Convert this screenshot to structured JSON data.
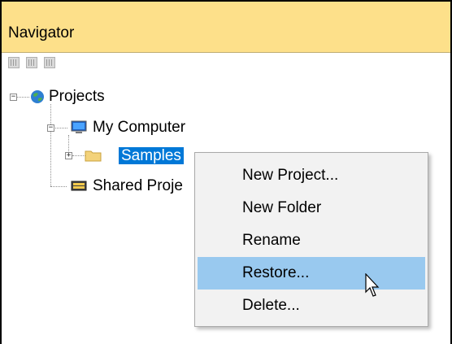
{
  "window": {
    "title": "Navigator"
  },
  "toolbar": {
    "buttons": [
      "grid-view-icon",
      "move-icon",
      "collapse-icon"
    ]
  },
  "tree": {
    "root": {
      "label": "Projects",
      "icon": "globe-icon"
    },
    "my_computer": {
      "label": "My Computer",
      "icon": "monitor-icon"
    },
    "samples": {
      "label": "Samples",
      "icon": "folder-icon"
    },
    "shared": {
      "label": "Shared Proje",
      "icon": "shared-drive-icon"
    }
  },
  "context_menu": {
    "items": [
      "New Project...",
      "New Folder",
      "Rename",
      "Restore...",
      "Delete..."
    ],
    "highlighted_index": 3
  },
  "colors": {
    "title_bar": "#fde08a",
    "selection": "#0078d7",
    "menu_highlight": "#99c9ef"
  }
}
